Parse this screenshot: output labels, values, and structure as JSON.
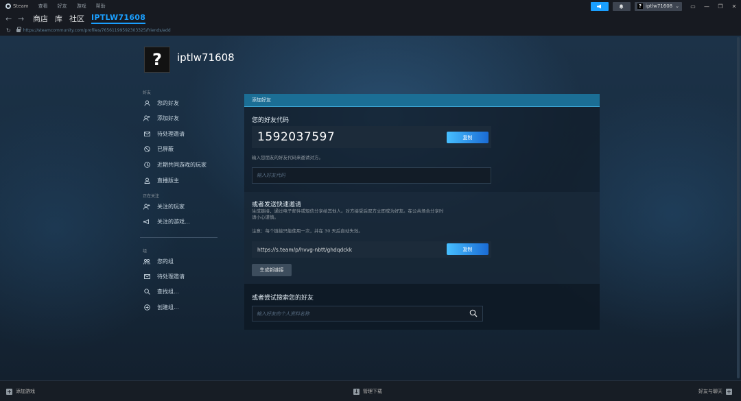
{
  "menubar": {
    "brand": "Steam",
    "items": [
      "查看",
      "好友",
      "游戏",
      "帮助"
    ],
    "account_name": "iptlw71608",
    "account_badge": "?"
  },
  "navbar": {
    "tabs": [
      "商店",
      "库",
      "社区"
    ],
    "active_tab": "IPTLW71608"
  },
  "urlbar": {
    "url": "https://steamcommunity.com/profiles/76561199592303325/friends/add"
  },
  "profile": {
    "avatar_glyph": "?",
    "name": "iptlw71608"
  },
  "sidebar": {
    "friends_heading": "好友",
    "friends_items": [
      {
        "label": "您的好友",
        "icon": "person-icon"
      },
      {
        "label": "添加好友",
        "icon": "add-person-icon"
      },
      {
        "label": "待处理邀请",
        "icon": "envelope-icon"
      },
      {
        "label": "已屏蔽",
        "icon": "blocked-icon"
      },
      {
        "label": "近期共同游戏的玩家",
        "icon": "clock-icon"
      },
      {
        "label": "直播版主",
        "icon": "moderator-icon"
      }
    ],
    "following_heading": "正在关注",
    "following_items": [
      {
        "label": "关注的玩家",
        "icon": "follow-person-icon"
      },
      {
        "label": "关注的游戏...",
        "icon": "follow-game-icon"
      }
    ],
    "groups_heading": "组",
    "groups_items": [
      {
        "label": "您的组",
        "icon": "group-icon"
      },
      {
        "label": "待处理邀请",
        "icon": "envelope-icon"
      },
      {
        "label": "查找组...",
        "icon": "search-icon"
      },
      {
        "label": "创建组...",
        "icon": "plus-circle-icon"
      }
    ]
  },
  "panel": {
    "header": "添加好友",
    "friend_code_heading": "您的好友代码",
    "friend_code": "1592037597",
    "copy_label": "复制",
    "invite_hint": "输入您朋友的好友代码来邀请对方。",
    "friend_code_placeholder": "输入好友代码",
    "quick_invite_heading": "或者发送快速邀请",
    "quick_invite_desc_line1": "生成链接，通过电子邮件或短信分享给其他人。对方接受后双方立即成为好友。在公共场合分享时",
    "quick_invite_desc_line2": "请小心谨慎。",
    "quick_invite_note": "注意：每个链接只能使用一次，并在 30 天后自动失效。",
    "invite_link": "https://s.team/p/hvvg-nbtt/ghdqdckk",
    "copy_link_label": "复制",
    "generate_label": "生成新链接",
    "search_heading": "或者尝试搜索您的好友",
    "search_placeholder": "输入好友的个人资料名称"
  },
  "bottombar": {
    "add_game": "添加游戏",
    "manage_downloads": "管理下载",
    "friends_chat": "好友与聊天"
  },
  "colors": {
    "accent": "#1a9fff",
    "header_bar": "#1b6e95",
    "background": "#1b2838"
  }
}
